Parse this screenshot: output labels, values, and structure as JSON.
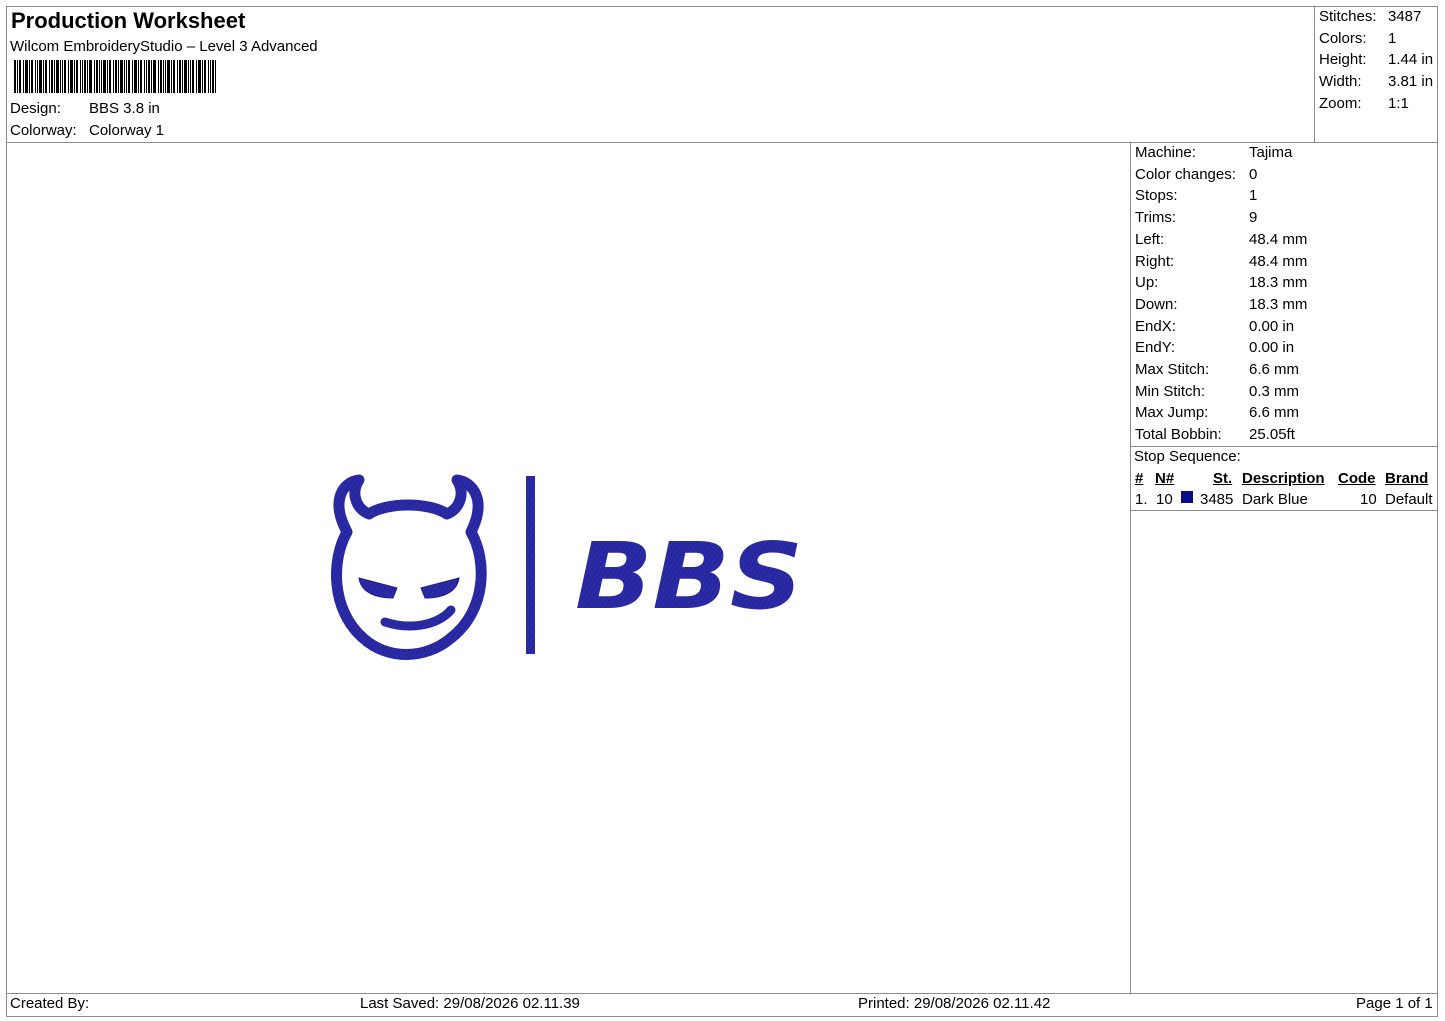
{
  "header": {
    "title": "Production Worksheet",
    "software": "Wilcom EmbroideryStudio – Level 3 Advanced",
    "design_label": "Design:",
    "design_value": "BBS 3.8 in",
    "colorway_label": "Colorway:",
    "colorway_value": "Colorway 1"
  },
  "stats": [
    {
      "label": "Stitches:",
      "value": "3487"
    },
    {
      "label": "Colors:",
      "value": "1"
    },
    {
      "label": "Height:",
      "value": "1.44 in"
    },
    {
      "label": "Width:",
      "value": "3.81 in"
    },
    {
      "label": "Zoom:",
      "value": "1:1"
    }
  ],
  "machine_info": [
    {
      "label": "Machine:",
      "value": "Tajima"
    },
    {
      "label": "Color changes:",
      "value": "0"
    },
    {
      "label": "Stops:",
      "value": "1"
    },
    {
      "label": "Trims:",
      "value": "9"
    },
    {
      "label": "Left:",
      "value": "48.4 mm"
    },
    {
      "label": "Right:",
      "value": "48.4 mm"
    },
    {
      "label": "Up:",
      "value": "18.3 mm"
    },
    {
      "label": "Down:",
      "value": "18.3 mm"
    },
    {
      "label": "EndX:",
      "value": "0.00 in"
    },
    {
      "label": "EndY:",
      "value": "0.00 in"
    },
    {
      "label": "Max Stitch:",
      "value": "6.6 mm"
    },
    {
      "label": "Min Stitch:",
      "value": "0.3 mm"
    },
    {
      "label": "Max Jump:",
      "value": "6.6 mm"
    },
    {
      "label": "Total Bobbin:",
      "value": "25.05ft"
    }
  ],
  "stop_sequence": {
    "title": "Stop Sequence:",
    "headers": {
      "num": "#",
      "needle": "N#",
      "stitches": "St.",
      "description": "Description",
      "code": "Code",
      "brand": "Brand"
    },
    "rows": [
      {
        "num": "1.",
        "needle": "10",
        "color": "#0a0a8c",
        "stitches": "3485",
        "description": "Dark Blue",
        "code": "10",
        "brand": "Default"
      }
    ]
  },
  "design": {
    "text": "BBS",
    "thread_color": "#2b2ba8",
    "icon": "devil-face-icon"
  },
  "footer": {
    "created_by": "Created By:",
    "last_saved": "Last Saved: 29/08/2026 02.11.39",
    "printed": "Printed: 29/08/2026 02.11.42",
    "page": "Page 1 of 1"
  }
}
